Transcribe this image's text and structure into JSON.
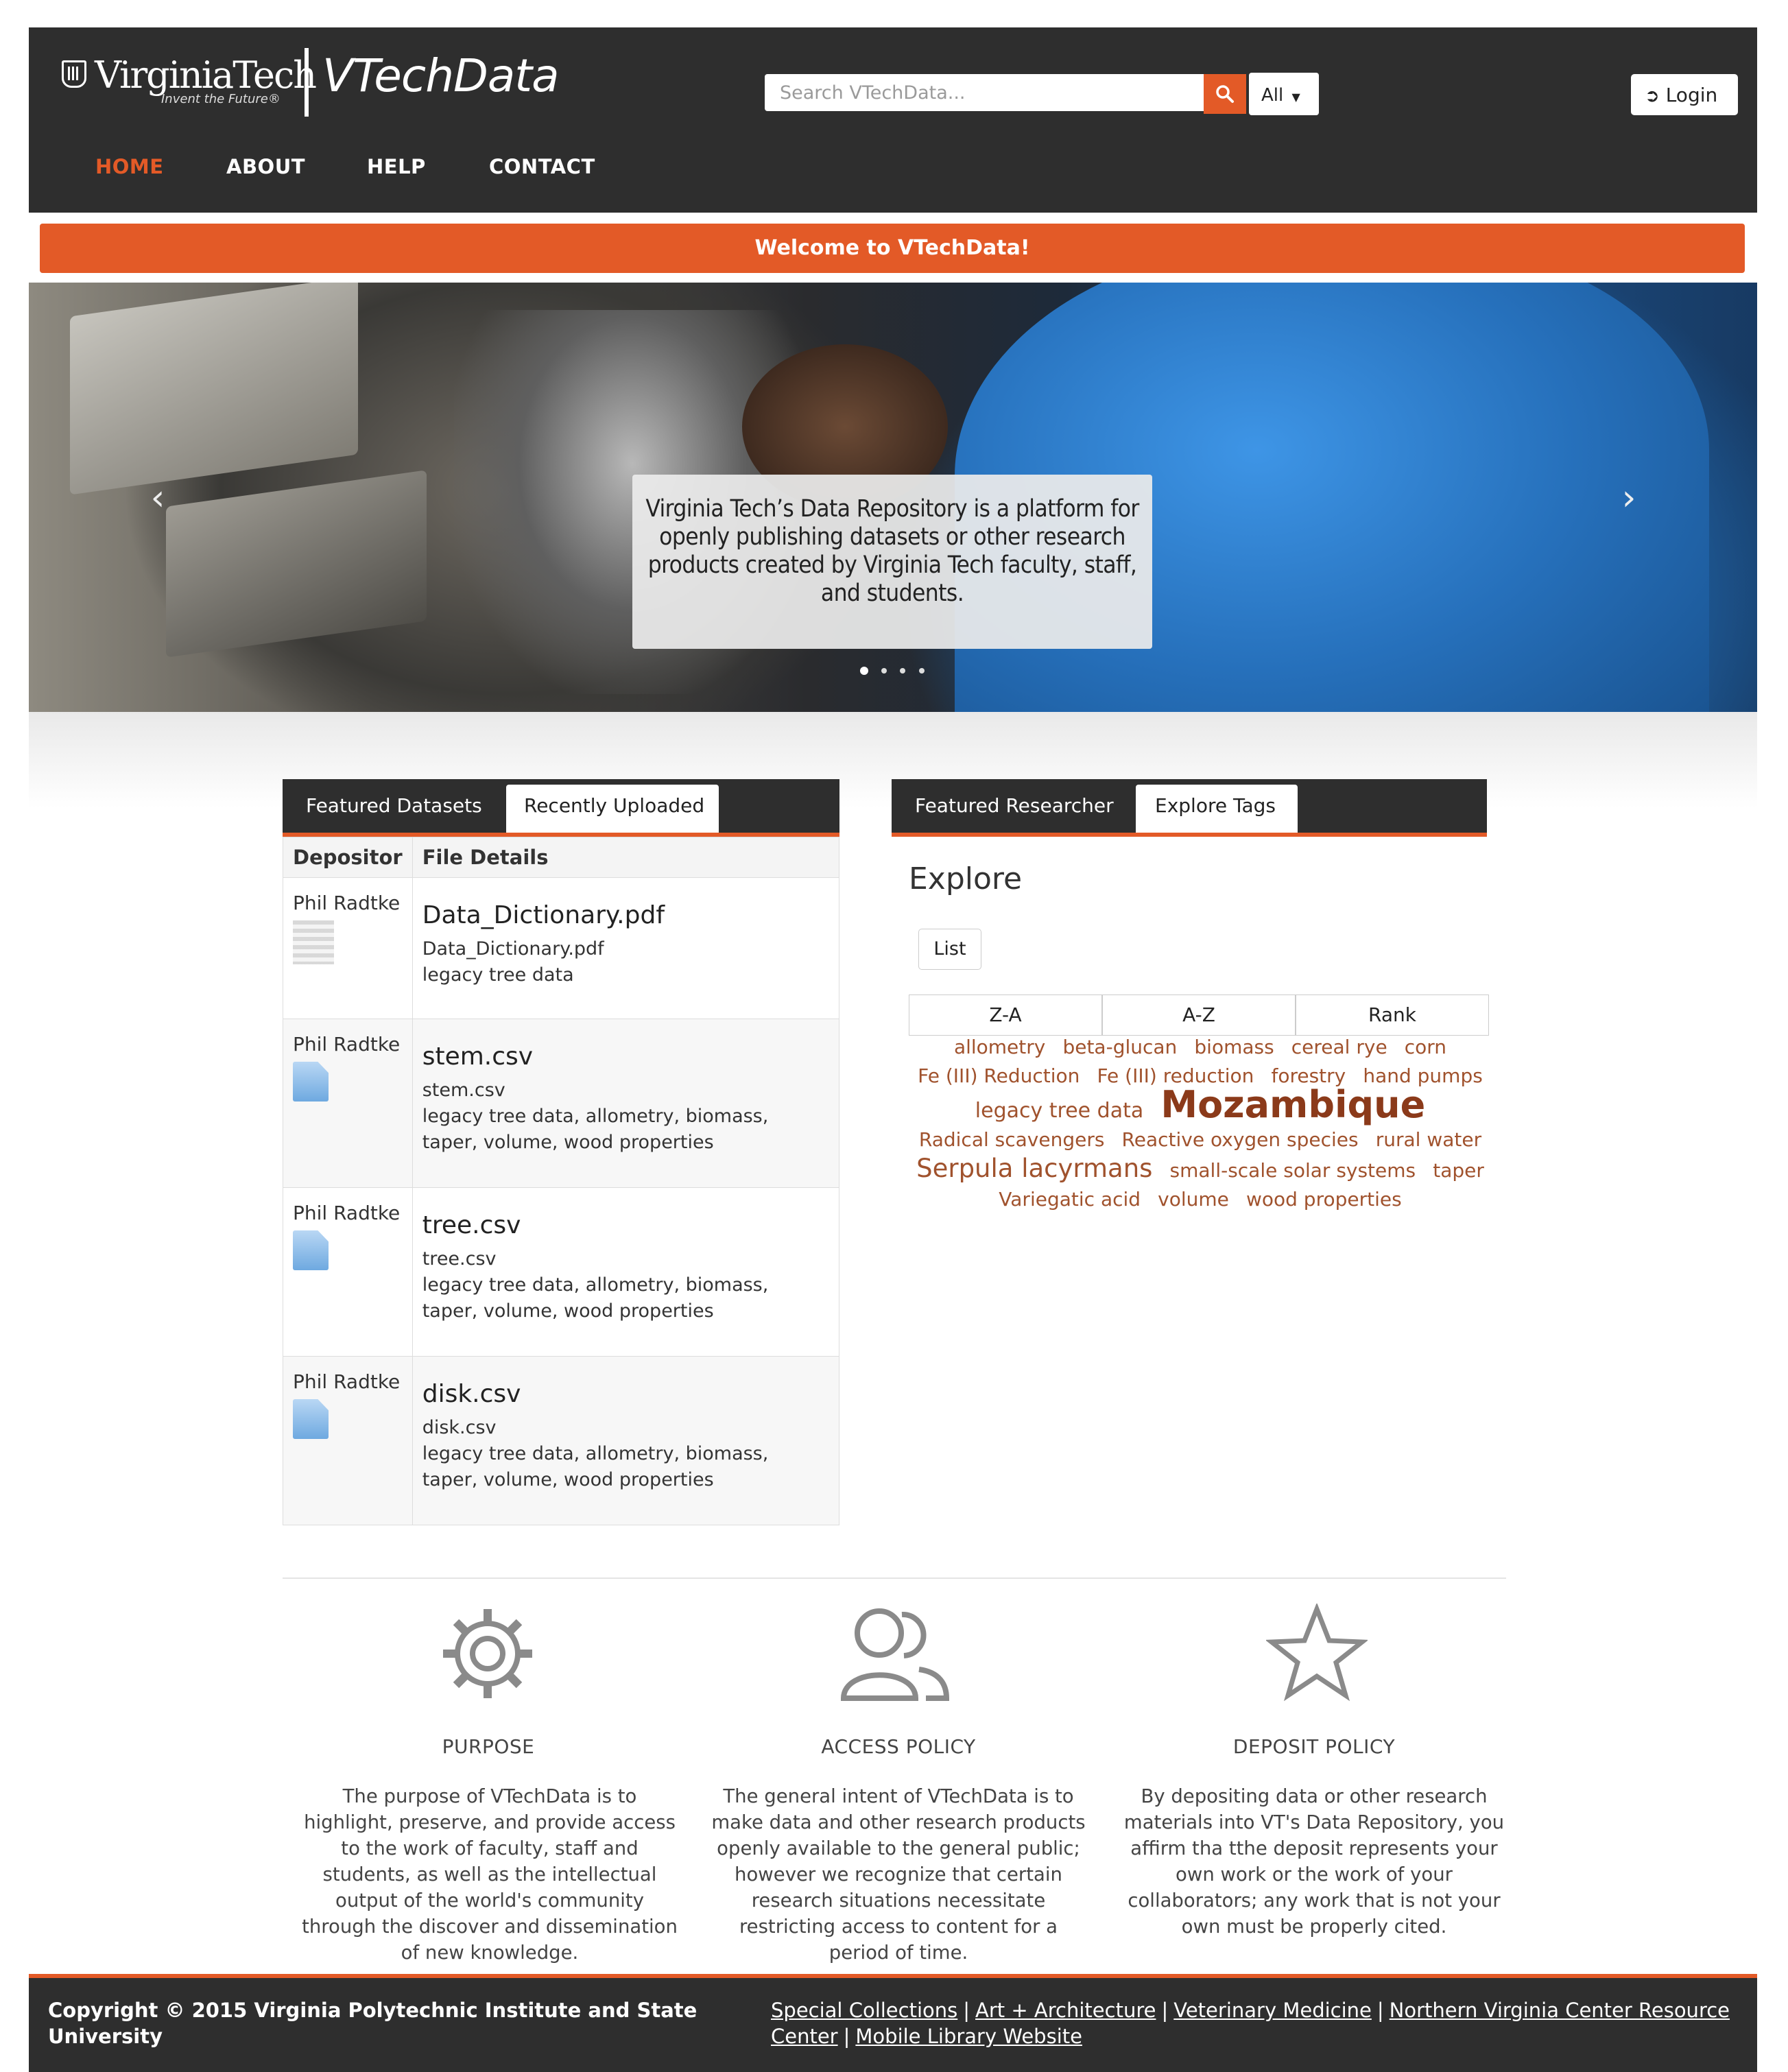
{
  "header": {
    "university_logo_text": "VirginiaTech",
    "university_tagline": "Invent the Future®",
    "site_title": "VTechData",
    "search_placeholder": "Search VTechData...",
    "search_scope": "All",
    "login_label": "Login"
  },
  "nav": {
    "items": [
      "HOME",
      "ABOUT",
      "HELP",
      "CONTACT"
    ],
    "active": "HOME"
  },
  "welcome": "Welcome to VTechData!",
  "carousel": {
    "caption": "Virginia Tech’s Data Repository is a platform for openly publishing datasets or other research products created by Virginia Tech faculty, staff, and students.",
    "slides": 4,
    "active_slide": 1
  },
  "datasets_panel": {
    "tabs": [
      "Featured Datasets",
      "Recently Uploaded"
    ],
    "active_tab": "Recently Uploaded",
    "headers": [
      "Depositor",
      "File Details"
    ],
    "rows": [
      {
        "depositor": "Phil Radtke",
        "file": "Data_Dictionary.pdf",
        "subname": "Data_Dictionary.pdf",
        "tags": "legacy tree data",
        "icon": "pdf-file-icon"
      },
      {
        "depositor": "Phil Radtke",
        "file": "stem.csv",
        "subname": "stem.csv",
        "tags": "legacy tree data, allometry, biomass, taper, volume, wood properties",
        "icon": "file-icon"
      },
      {
        "depositor": "Phil Radtke",
        "file": "tree.csv",
        "subname": "tree.csv",
        "tags": "legacy tree data, allometry, biomass, taper, volume, wood properties",
        "icon": "file-icon"
      },
      {
        "depositor": "Phil Radtke",
        "file": "disk.csv",
        "subname": "disk.csv",
        "tags": "legacy tree data, allometry, biomass, taper, volume, wood properties",
        "icon": "file-icon"
      }
    ]
  },
  "tags_panel": {
    "tabs": [
      "Featured Researcher",
      "Explore Tags"
    ],
    "active_tab": "Explore Tags",
    "title": "Explore",
    "list_button": "List",
    "sort_buttons": [
      "Z-A",
      "A-Z",
      "Rank"
    ],
    "tags": [
      {
        "text": "allometry",
        "size": "normal"
      },
      {
        "text": "beta-glucan",
        "size": "normal"
      },
      {
        "text": "biomass",
        "size": "normal"
      },
      {
        "text": "cereal rye",
        "size": "normal"
      },
      {
        "text": "corn",
        "size": "normal"
      },
      {
        "text": "Fe (III) Reduction",
        "size": "normal"
      },
      {
        "text": "Fe (III) reduction",
        "size": "normal"
      },
      {
        "text": "forestry",
        "size": "normal"
      },
      {
        "text": "hand pumps",
        "size": "normal"
      },
      {
        "text": "legacy tree data",
        "size": "medium-small"
      },
      {
        "text": "Mozambique",
        "size": "big"
      },
      {
        "text": "Radical scavengers",
        "size": "normal"
      },
      {
        "text": "Reactive oxygen species",
        "size": "normal"
      },
      {
        "text": "rural water",
        "size": "normal"
      },
      {
        "text": "Serpula lacyrmans",
        "size": "medium"
      },
      {
        "text": "small-scale solar systems",
        "size": "normal"
      },
      {
        "text": "taper",
        "size": "normal"
      },
      {
        "text": "Variegatic acid",
        "size": "normal"
      },
      {
        "text": "volume",
        "size": "normal"
      },
      {
        "text": "wood properties",
        "size": "normal"
      }
    ],
    "tag_color": "#a0522d"
  },
  "info": [
    {
      "icon": "gear-icon",
      "title": "PURPOSE",
      "text": "The purpose of VTechData is to highlight, preserve, and provide access to the work of faculty, staff and students, as well as the intellectual output of the world's community through the discover and dissemination of new knowledge."
    },
    {
      "icon": "users-icon",
      "title": "ACCESS POLICY",
      "text": "The general intent of VTechData is to make data and other research products openly available to the general public; however we recognize that certain research situations necessitate restricting access to content for a period of time."
    },
    {
      "icon": "star-icon",
      "title": "DEPOSIT POLICY",
      "text": "By depositing data or other research materials into VT's Data Repository, you affirm tha tthe deposit represents your own work or the work of your collaborators; any work that is not your own must be properly cited."
    }
  ],
  "footer": {
    "copyright": "Copyright © 2015 Virginia Polytechnic Institute and State University",
    "links": [
      "Special Collections",
      "Art + Architecture",
      "Veterinary Medicine",
      "Northern Virginia Center Resource Center",
      "Mobile Library Website"
    ]
  },
  "colors": {
    "accent": "#e35a27",
    "header_bg": "#2e2e2e",
    "tag_text": "#a0522d"
  }
}
